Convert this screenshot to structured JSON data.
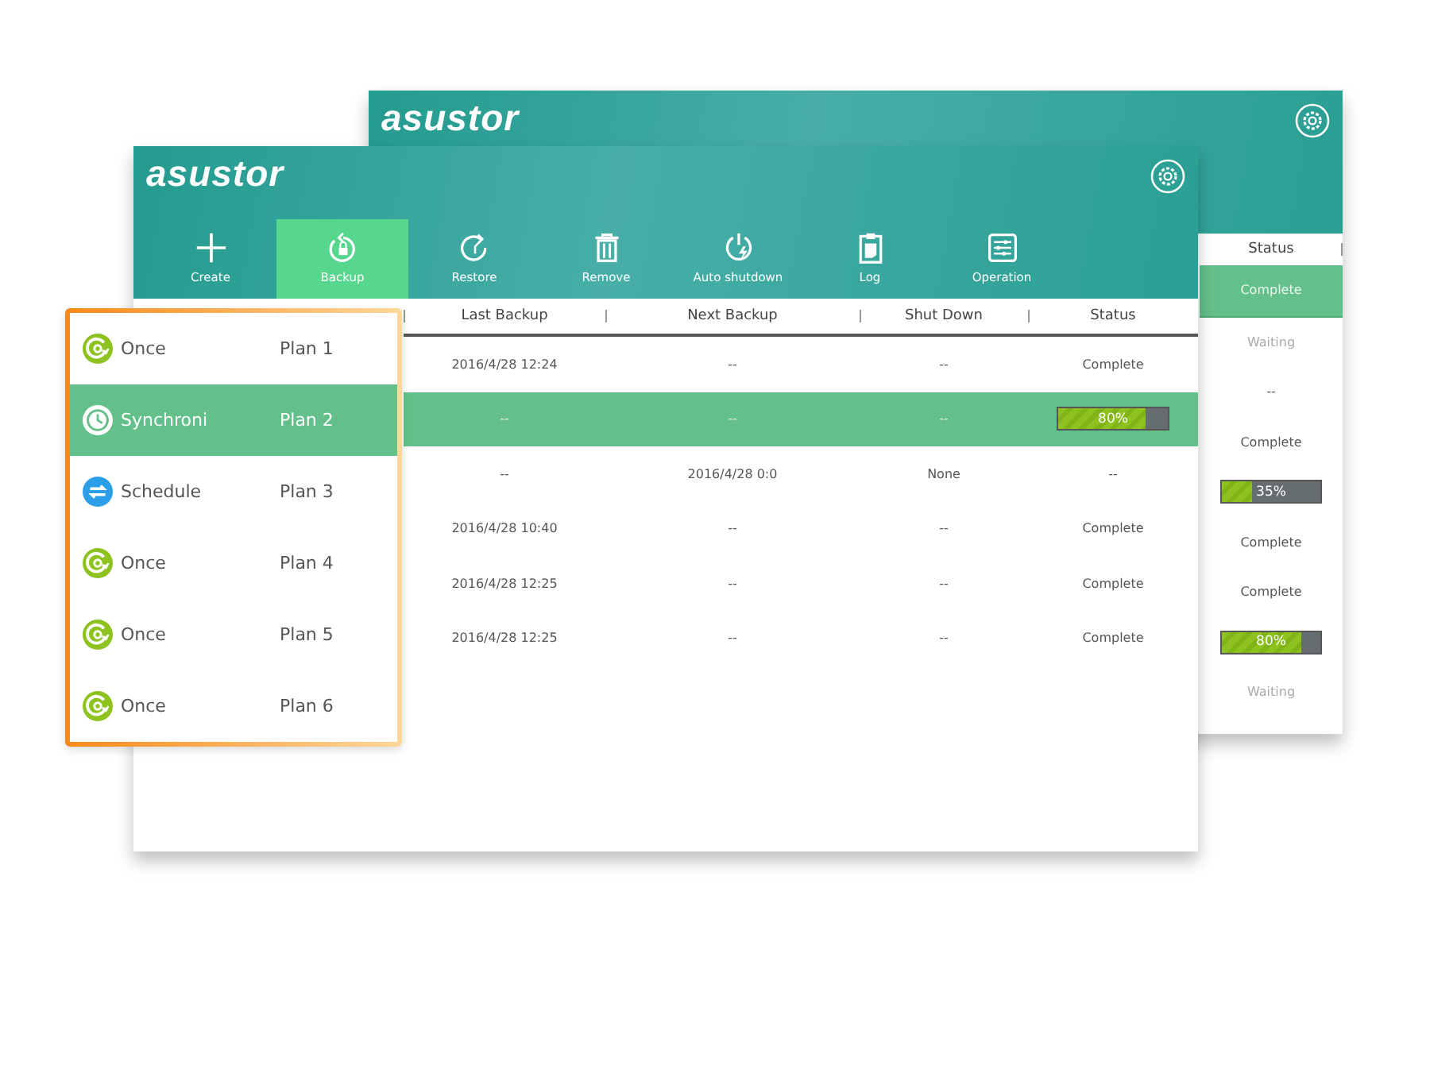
{
  "back_window": {
    "logo": "asustor",
    "table": {
      "columns": [
        "Status"
      ],
      "rows": [
        {
          "kind": "text",
          "status": "Complete",
          "selected": true
        },
        {
          "kind": "muted",
          "status": "Waiting",
          "selected": false
        },
        {
          "kind": "text",
          "status": "--",
          "selected": false
        },
        {
          "kind": "text",
          "status": "Complete",
          "selected": false
        },
        {
          "kind": "progress",
          "status": "35%",
          "level": 0.3,
          "selected": false
        },
        {
          "kind": "text",
          "status": "Complete",
          "selected": false
        },
        {
          "kind": "text",
          "status": "Complete",
          "selected": false
        },
        {
          "kind": "progress",
          "status": "80%",
          "level": 0.8,
          "selected": false
        },
        {
          "kind": "muted",
          "status": "Waiting",
          "selected": false
        }
      ]
    }
  },
  "front_window": {
    "logo": "asustor",
    "toolbar": [
      {
        "label": "Create",
        "selected": false
      },
      {
        "label": "Backup",
        "selected": true
      },
      {
        "label": "Restore",
        "selected": false
      },
      {
        "label": "Remove",
        "selected": false
      },
      {
        "label": "Auto shutdown",
        "selected": false
      },
      {
        "label": "Log",
        "selected": false
      },
      {
        "label": "Operation",
        "selected": false
      }
    ],
    "table": {
      "columns": [
        "Last Backup",
        "Next Backup",
        "Shut Down",
        "Status"
      ],
      "rows": [
        {
          "last_backup": "2016/4/28 12:24",
          "next_backup": "--",
          "shut_down": "--",
          "kind": "text",
          "status": "Complete",
          "selected": false
        },
        {
          "last_backup": "--",
          "next_backup": "--",
          "shut_down": "--",
          "kind": "progress",
          "status": "80%",
          "level": 0.8,
          "selected": true
        },
        {
          "last_backup": "--",
          "next_backup": "2016/4/28 0:0",
          "shut_down": "None",
          "kind": "text",
          "status": "--",
          "selected": false
        },
        {
          "last_backup": "2016/4/28 10:40",
          "next_backup": "--",
          "shut_down": "--",
          "kind": "text",
          "status": "Complete",
          "selected": false
        },
        {
          "last_backup": "2016/4/28 12:25",
          "next_backup": "--",
          "shut_down": "--",
          "kind": "text",
          "status": "Complete",
          "selected": false
        },
        {
          "last_backup": "2016/4/28 12:25",
          "next_backup": "--",
          "shut_down": "--",
          "kind": "text",
          "status": "Complete",
          "selected": false
        }
      ]
    }
  },
  "plan_panel": {
    "items": [
      {
        "kind": "once",
        "type": "Once",
        "name": "Plan 1",
        "selected": false
      },
      {
        "kind": "sync",
        "type": "Synchroni",
        "name": "Plan 2",
        "selected": true
      },
      {
        "kind": "schedule",
        "type": "Schedule",
        "name": "Plan 3",
        "selected": false
      },
      {
        "kind": "once",
        "type": "Once",
        "name": "Plan 4",
        "selected": false
      },
      {
        "kind": "once",
        "type": "Once",
        "name": "Plan 5",
        "selected": false
      },
      {
        "kind": "once",
        "type": "Once",
        "name": "Plan 6",
        "selected": false
      }
    ]
  }
}
